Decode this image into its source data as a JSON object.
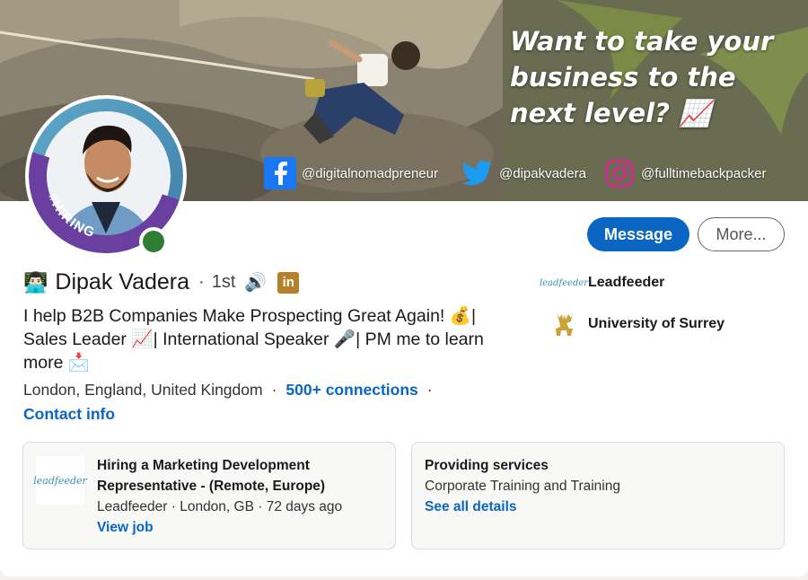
{
  "banner": {
    "tagline": "Want to take your business to the next level? 📈",
    "social": [
      {
        "icon": "facebook-icon",
        "handle": "@digitalnomadpreneur",
        "color": "#1877f2"
      },
      {
        "icon": "twitter-icon",
        "handle": "@dipakvadera",
        "color": "#1d9bf0"
      },
      {
        "icon": "instagram-icon",
        "handle": "@fulltimebackpacker",
        "color": "#c13584"
      }
    ]
  },
  "avatar": {
    "frame_text": "#HIRING",
    "frame_color": "#6b3fa0"
  },
  "actions": {
    "message": "Message",
    "more": "More..."
  },
  "profile": {
    "emoji": "👨🏻‍💻",
    "name": "Dipak Vadera",
    "separator": "·",
    "degree": "1st",
    "speaker": "🔊",
    "badge": "in",
    "headline": "I help B2B Companies Make Prospecting Great Again! 💰| Sales Leader 📈| International Speaker 🎤| PM me to learn more 📩",
    "location": "London, England, United Kingdom",
    "dot": "·",
    "connections": "500+ connections",
    "contact": "Contact info"
  },
  "companies": [
    {
      "name": "Leadfeeder",
      "logo_text": "leadfeeder"
    },
    {
      "name": "University of Surrey",
      "logo_icon": "stag-icon"
    }
  ],
  "hiring": {
    "logo_text": "leadfeeder",
    "title": "Hiring a Marketing Development Representative - (Remote, Europe)",
    "meta": "Leadfeeder · London, GB · 72 days ago",
    "link": "View job"
  },
  "services": {
    "title": "Providing services",
    "items": "Corporate Training and Training",
    "link": "See all details"
  },
  "colors": {
    "accent": "#0a66c2",
    "online": "#2e7d32",
    "linkedin_badge": "#b5802a"
  }
}
